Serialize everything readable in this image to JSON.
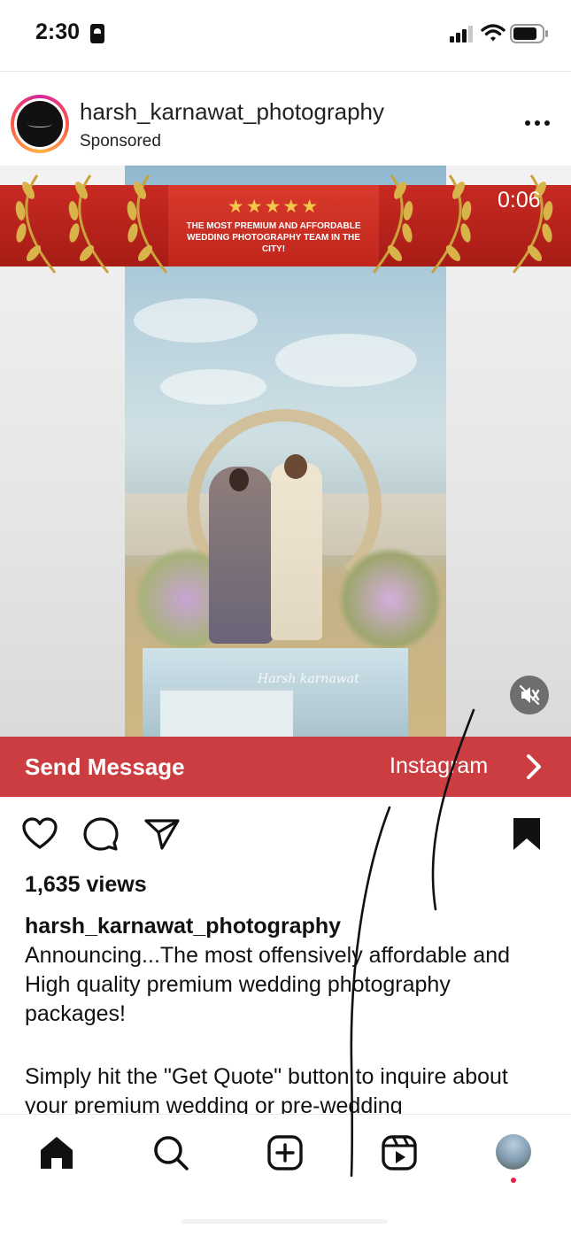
{
  "status_bar": {
    "time": "2:30",
    "icons": [
      "sim-card-icon",
      "cellular-signal-icon",
      "wifi-icon",
      "battery-icon"
    ]
  },
  "post": {
    "username": "harsh_karnawat_photography",
    "label": "Sponsored",
    "more_icon": "more-horizontal-icon",
    "media": {
      "banner_rating": "★★★★★",
      "banner_text": "THE MOST PREMIUM AND AFFORDABLE WEDDING PHOTOGRAPHY TEAM IN THE CITY!",
      "timer": "0:06",
      "mute_icon": "muted-speaker-icon",
      "watermark": "Harsh karnawat"
    },
    "cta": {
      "label": "Send Message",
      "source": "Instagram",
      "chevron_icon": "chevron-right-icon"
    },
    "actions": {
      "like_icon": "heart-icon",
      "comment_icon": "comment-icon",
      "share_icon": "send-icon",
      "save_icon": "bookmark-filled-icon"
    },
    "views": "1,635 views",
    "caption": {
      "username": "harsh_karnawat_photography",
      "line1": "Announcing...The most offensively affordable and High quality premium wedding photography packages!",
      "line2": "Simply hit the \"Get Quote\" button to inquire about your premium wedding or pre-wedding"
    }
  },
  "bottom_nav": {
    "items": [
      "home-icon",
      "search-icon",
      "create-icon",
      "reels-icon",
      "profile-avatar"
    ],
    "notification_color": "#ed1d45"
  },
  "colors": {
    "cta_background": "#cb3d40",
    "banner_red": "#c62a22",
    "star_gold": "#f4c64a"
  }
}
